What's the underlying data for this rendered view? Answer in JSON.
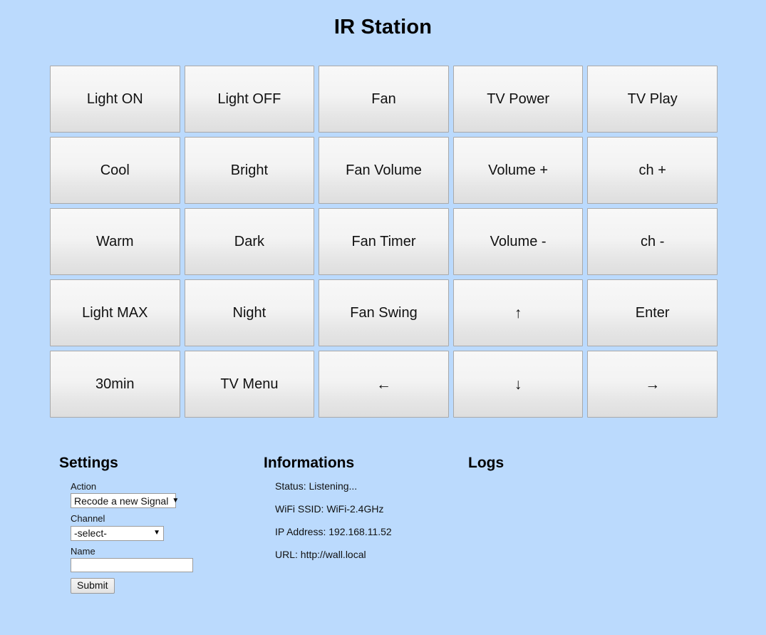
{
  "page": {
    "title": "IR Station",
    "background_color": "#bbdafd"
  },
  "button_grid": {
    "columns": 5,
    "rows": 5,
    "buttons": [
      {
        "label": "Light ON",
        "name": "ir-button-light-on"
      },
      {
        "label": "Light OFF",
        "name": "ir-button-light-off"
      },
      {
        "label": "Fan",
        "name": "ir-button-fan"
      },
      {
        "label": "TV Power",
        "name": "ir-button-tv-power"
      },
      {
        "label": "TV Play",
        "name": "ir-button-tv-play"
      },
      {
        "label": "Cool",
        "name": "ir-button-cool"
      },
      {
        "label": "Bright",
        "name": "ir-button-bright"
      },
      {
        "label": "Fan Volume",
        "name": "ir-button-fan-volume"
      },
      {
        "label": "Volume +",
        "name": "ir-button-volume-up"
      },
      {
        "label": "ch +",
        "name": "ir-button-channel-up"
      },
      {
        "label": "Warm",
        "name": "ir-button-warm"
      },
      {
        "label": "Dark",
        "name": "ir-button-dark"
      },
      {
        "label": "Fan Timer",
        "name": "ir-button-fan-timer"
      },
      {
        "label": "Volume -",
        "name": "ir-button-volume-down"
      },
      {
        "label": "ch -",
        "name": "ir-button-channel-down"
      },
      {
        "label": "Light MAX",
        "name": "ir-button-light-max"
      },
      {
        "label": "Night",
        "name": "ir-button-night"
      },
      {
        "label": "Fan Swing",
        "name": "ir-button-fan-swing"
      },
      {
        "label": "↑",
        "name": "ir-button-arrow-up-icon",
        "arrow": true
      },
      {
        "label": "Enter",
        "name": "ir-button-enter"
      },
      {
        "label": "30min",
        "name": "ir-button-30min"
      },
      {
        "label": "TV Menu",
        "name": "ir-button-tv-menu"
      },
      {
        "label": "←",
        "name": "ir-button-arrow-left-icon",
        "arrow": true
      },
      {
        "label": "↓",
        "name": "ir-button-arrow-down-icon",
        "arrow": true
      },
      {
        "label": "→",
        "name": "ir-button-arrow-right-icon",
        "arrow": true
      }
    ]
  },
  "settings": {
    "heading": "Settings",
    "action": {
      "label": "Action",
      "value": "Recode a new Signal",
      "caret": "▼",
      "options": [
        "Recode a new Signal"
      ]
    },
    "channel": {
      "label": "Channel",
      "value": "-select-",
      "caret": "▼",
      "options": [
        "-select-"
      ]
    },
    "name": {
      "label": "Name",
      "value": "",
      "placeholder": ""
    },
    "submit_label": "Submit"
  },
  "informations": {
    "heading": "Informations",
    "items": [
      "Status: Listening...",
      "WiFi SSID: WiFi-2.4GHz",
      "IP Address: 192.168.11.52",
      "URL: http://wall.local"
    ]
  },
  "logs": {
    "heading": "Logs",
    "items": []
  }
}
